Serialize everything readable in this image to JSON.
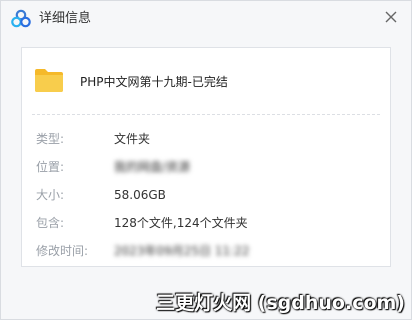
{
  "window": {
    "title": "详细信息"
  },
  "file": {
    "name": "PHP中文网第十九期-已完结"
  },
  "details": [
    {
      "key": "type",
      "label": "类型:",
      "value": "文件夹",
      "obscured": false
    },
    {
      "key": "location",
      "label": "位置:",
      "value": "我的网盘/资源",
      "obscured": true
    },
    {
      "key": "size",
      "label": "大小:",
      "value": "58.06GB",
      "obscured": false
    },
    {
      "key": "contents",
      "label": "包含:",
      "value": "128个文件,124个文件夹",
      "obscured": false
    },
    {
      "key": "modified",
      "label": "修改时间:",
      "value": "2023年09月25日 11:22",
      "obscured": true
    }
  ],
  "watermark": "三更灯火网 (sgdhuo.com)",
  "colors": {
    "accent": "#3a7bd5",
    "folder": "#f7c948"
  }
}
